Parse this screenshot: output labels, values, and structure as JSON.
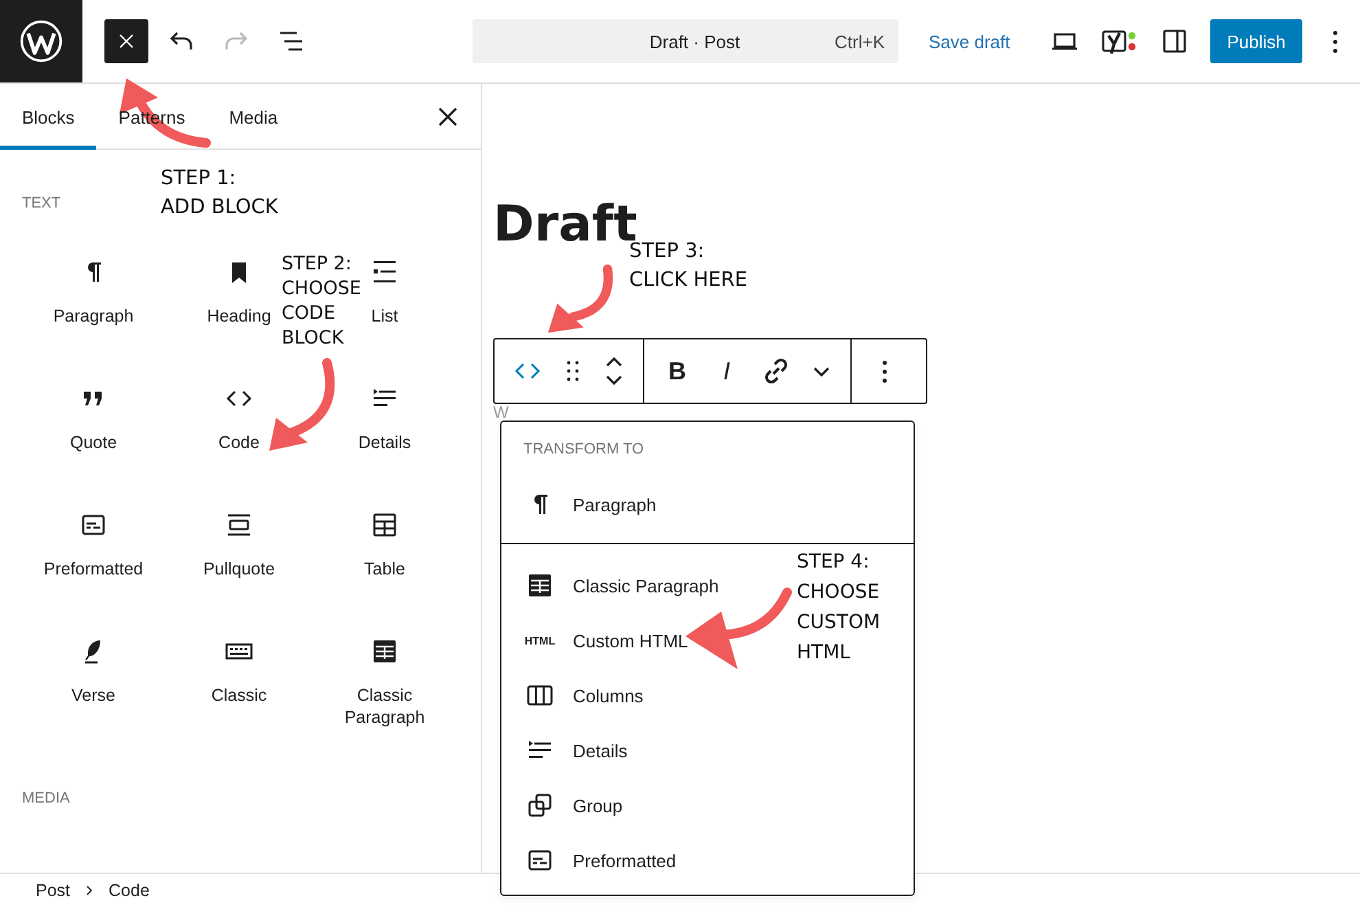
{
  "topbar": {
    "command": "Draft · Post",
    "shortcut": "Ctrl+K",
    "save": "Save draft",
    "publish": "Publish",
    "history": [
      {
        "kind": "undo",
        "disabled": false
      },
      {
        "kind": "redo",
        "disabled": true
      }
    ]
  },
  "inserter": {
    "tabs": [
      {
        "label": "Blocks",
        "selected": true
      },
      {
        "label": "Patterns",
        "selected": false
      },
      {
        "label": "Media",
        "selected": false
      }
    ],
    "sections": [
      {
        "heading": "TEXT",
        "blocks": [
          {
            "label": "Paragraph",
            "kind": "paragraph"
          },
          {
            "label": "Heading",
            "kind": "heading"
          },
          {
            "label": "List",
            "kind": "list"
          },
          {
            "label": "Quote",
            "kind": "quote"
          },
          {
            "label": "Code",
            "kind": "code"
          },
          {
            "label": "Details",
            "kind": "details"
          },
          {
            "label": "Preformatted",
            "kind": "preformatted"
          },
          {
            "label": "Pullquote",
            "kind": "pullquote"
          },
          {
            "label": "Table",
            "kind": "table"
          },
          {
            "label": "Verse",
            "kind": "verse"
          },
          {
            "label": "Classic",
            "kind": "classic"
          },
          {
            "label": "Classic Paragraph",
            "kind": "classicparagraph"
          }
        ]
      },
      {
        "heading": "MEDIA"
      }
    ]
  },
  "breadcrumb": [
    "Post",
    "Code"
  ],
  "editor": {
    "title": "Draft",
    "placeholder": "W",
    "toolbar": {
      "switcher_open": true,
      "format": [
        {
          "kind": "bold",
          "label": "B"
        },
        {
          "kind": "italic",
          "label": "I"
        },
        {
          "kind": "link"
        },
        {
          "kind": "more"
        }
      ]
    },
    "transform": {
      "heading": "TRANSFORM TO",
      "groups": [
        [
          {
            "label": "Paragraph",
            "kind": "paragraph"
          }
        ],
        [
          {
            "label": "Classic Paragraph",
            "kind": "classicparagraph"
          },
          {
            "label": "Custom HTML",
            "kind": "html",
            "icon_text": "HTML"
          },
          {
            "label": "Columns",
            "kind": "columns"
          },
          {
            "label": "Details",
            "kind": "details"
          },
          {
            "label": "Group",
            "kind": "group"
          },
          {
            "label": "Preformatted",
            "kind": "preformatted"
          }
        ]
      ]
    }
  },
  "annotations": [
    {
      "lines": [
        "STEP 1:",
        "ADD BLOCK"
      ]
    },
    {
      "lines": [
        "STEP 2:",
        "CHOOSE",
        "CODE",
        "BLOCK"
      ]
    },
    {
      "lines": [
        "STEP 3:",
        "CLICK HERE"
      ]
    },
    {
      "lines": [
        "STEP 4:",
        "CHOOSE",
        "CUSTOM",
        "HTML"
      ]
    }
  ]
}
